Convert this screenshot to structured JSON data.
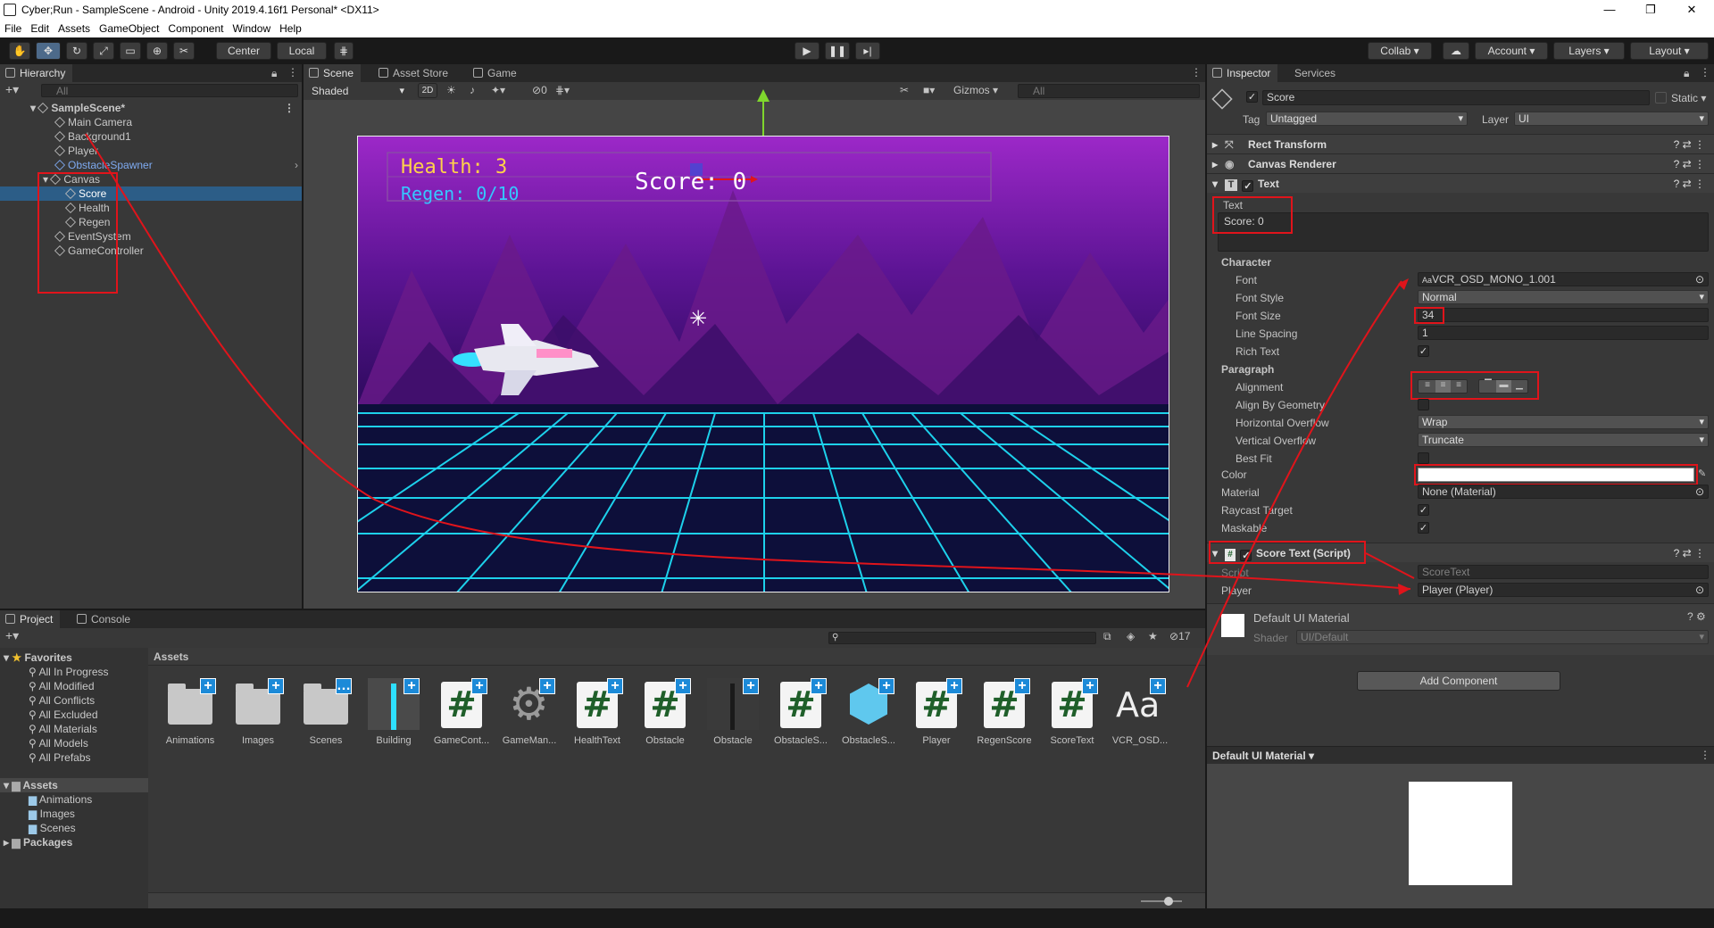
{
  "window": {
    "title": "Cyber;Run - SampleScene - Android - Unity 2019.4.16f1 Personal* <DX11>"
  },
  "menu": [
    "File",
    "Edit",
    "Assets",
    "GameObject",
    "Component",
    "Window",
    "Help"
  ],
  "toolbar": {
    "pivot": "Center",
    "space": "Local",
    "collab": "Collab",
    "account": "Account",
    "layers": "Layers",
    "layout": "Layout"
  },
  "hierarchy": {
    "tab": "Hierarchy",
    "search_placeholder": "All",
    "scene": "SampleScene*",
    "items": [
      "Main Camera",
      "Background1",
      "Player",
      "ObstacleSpawner",
      "Canvas",
      "Score",
      "Health",
      "Regen",
      "EventSystem",
      "GameController"
    ]
  },
  "scene_view": {
    "tabs": [
      "Scene",
      "Asset Store",
      "Game"
    ],
    "shading": "Shaded",
    "mode_2d": "2D",
    "hidden_count": "0",
    "gizmos": "Gizmos",
    "search_placeholder": "All",
    "hud": {
      "health": "Health: 3",
      "regen": "Regen: 0/10",
      "score": "Score: 0"
    }
  },
  "inspector": {
    "tabs": [
      "Inspector",
      "Services"
    ],
    "object_name": "Score",
    "static_label": "Static",
    "tag_label": "Tag",
    "tag_value": "Untagged",
    "layer_label": "Layer",
    "layer_value": "UI",
    "components": {
      "rect_transform": "Rect Transform",
      "canvas_renderer": "Canvas Renderer",
      "text": "Text",
      "score_script": "Score Text (Script)"
    },
    "text_label": "Text",
    "text_value": "Score: 0",
    "character_header": "Character",
    "font_label": "Font",
    "font_value": "VCR_OSD_MONO_1.001",
    "font_style_label": "Font Style",
    "font_style_value": "Normal",
    "font_size_label": "Font Size",
    "font_size_value": "34",
    "line_spacing_label": "Line Spacing",
    "line_spacing_value": "1",
    "rich_text_label": "Rich Text",
    "paragraph_header": "Paragraph",
    "alignment_label": "Alignment",
    "align_geometry_label": "Align By Geometry",
    "h_overflow_label": "Horizontal Overflow",
    "h_overflow_value": "Wrap",
    "v_overflow_label": "Vertical Overflow",
    "v_overflow_value": "Truncate",
    "best_fit_label": "Best Fit",
    "color_label": "Color",
    "material_label": "Material",
    "material_value": "None (Material)",
    "raycast_label": "Raycast Target",
    "maskable_label": "Maskable",
    "script_label": "Script",
    "script_value": "ScoreText",
    "player_label": "Player",
    "player_value": "Player (Player)",
    "material_name": "Default UI Material",
    "shader_label": "Shader",
    "shader_value": "UI/Default",
    "add_component": "Add Component",
    "preview_title": "Default UI Material"
  },
  "project": {
    "tabs": [
      "Project",
      "Console"
    ],
    "favorites_header": "Favorites",
    "favorites": [
      "All In Progress",
      "All Modified",
      "All Conflicts",
      "All Excluded",
      "All Materials",
      "All Models",
      "All Prefabs"
    ],
    "assets_header": "Assets",
    "asset_folders": [
      "Animations",
      "Images",
      "Scenes"
    ],
    "packages": "Packages",
    "breadcrumb": "Assets",
    "hidden_count": "17",
    "assets": [
      "Animations",
      "Images",
      "Scenes",
      "Building",
      "GameCont...",
      "GameMan...",
      "HealthText",
      "Obstacle",
      "Obstacle",
      "ObstacleS...",
      "ObstacleS...",
      "Player",
      "RegenScore",
      "ScoreText",
      "VCR_OSD..."
    ]
  },
  "colors": {
    "accent": "#3a72b0",
    "highlight": "#e0141b",
    "script_green": "#1f5f2a"
  }
}
